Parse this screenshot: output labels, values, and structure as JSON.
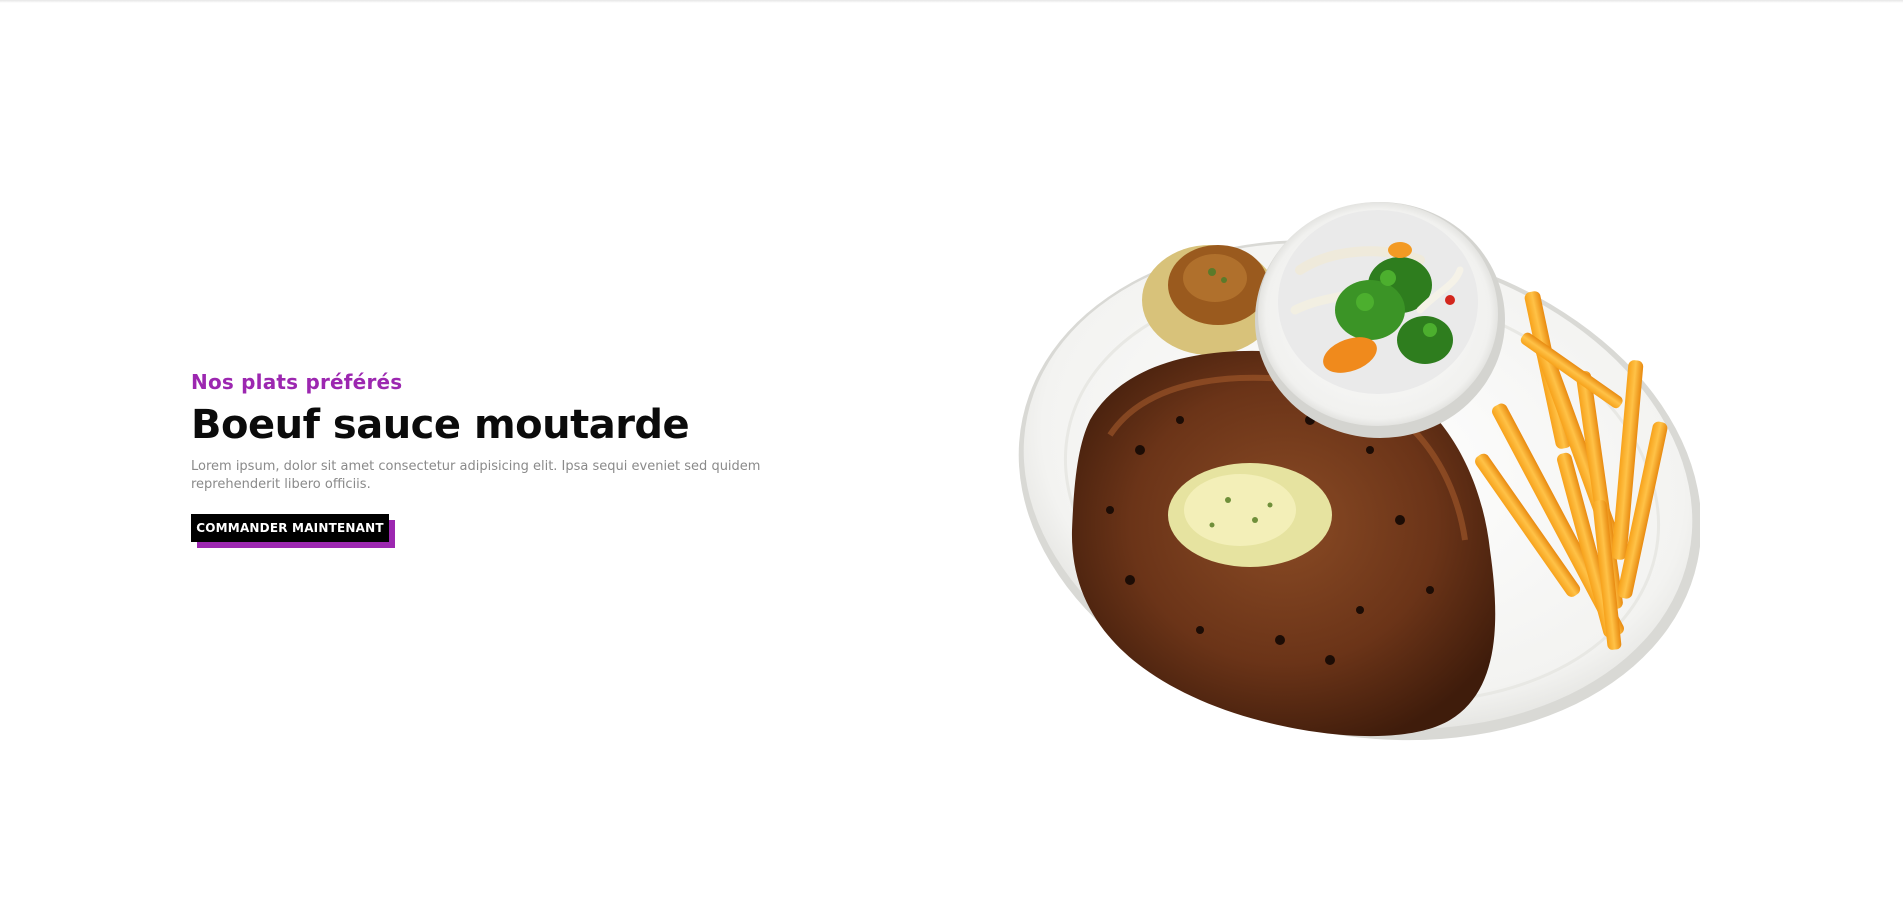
{
  "hero": {
    "subtitle": "Nos plats préférés",
    "title": "Boeuf sauce moutarde",
    "description": "Lorem ipsum, dolor sit amet consectetur adipisicing elit. Ipsa sequi eveniet sed quidem reprehenderit libero officiis.",
    "cta_label": "COMMANDER MAINTENANT"
  },
  "colors": {
    "accent": "#9c27b0",
    "text": "#0b0b0b",
    "muted": "#8a8a8a",
    "button_bg": "#000000"
  },
  "image": {
    "subject": "steak-with-fries-and-salad-plate"
  }
}
